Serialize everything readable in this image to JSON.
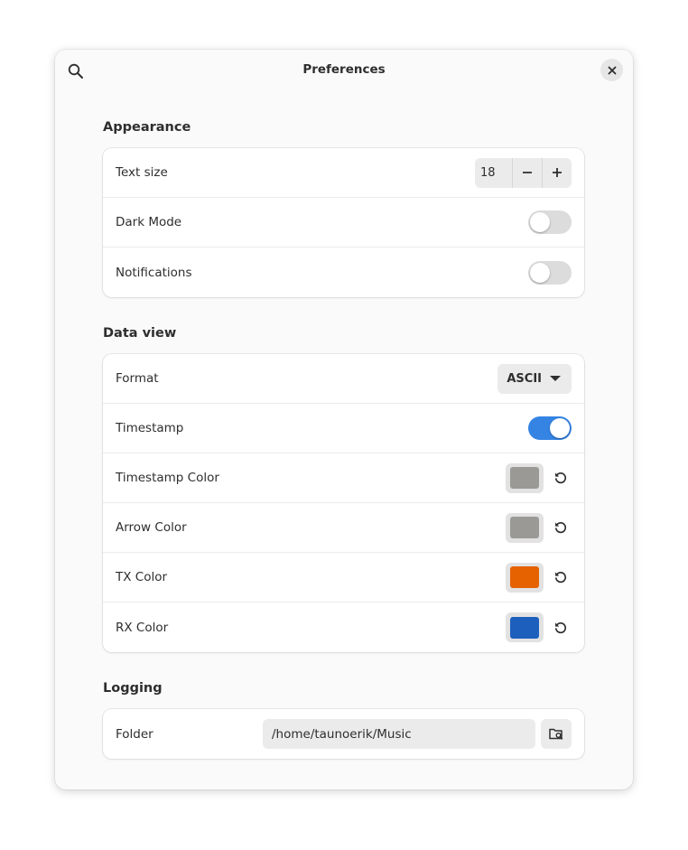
{
  "window": {
    "title": "Preferences"
  },
  "appearance": {
    "heading": "Appearance",
    "text_size": {
      "label": "Text size",
      "value": "18"
    },
    "dark_mode": {
      "label": "Dark Mode",
      "enabled": false
    },
    "notifications": {
      "label": "Notifications",
      "enabled": false
    }
  },
  "data_view": {
    "heading": "Data view",
    "format": {
      "label": "Format",
      "selected": "ASCII"
    },
    "timestamp": {
      "label": "Timestamp",
      "enabled": true
    },
    "timestamp_color": {
      "label": "Timestamp Color",
      "color": "#9a9996"
    },
    "arrow_color": {
      "label": "Arrow Color",
      "color": "#9a9996"
    },
    "tx_color": {
      "label": "TX Color",
      "color": "#e66100"
    },
    "rx_color": {
      "label": "RX Color",
      "color": "#1c5fbd"
    }
  },
  "logging": {
    "heading": "Logging",
    "folder": {
      "label": "Folder",
      "path": "/home/taunoerik/Music"
    }
  },
  "colors": {
    "accent": "#3584e4",
    "switch_off": "#dcdcdc"
  },
  "icons": {
    "search": "search-icon",
    "close": "close-icon",
    "minus": "minus-icon",
    "plus": "plus-icon",
    "dropdown": "chevron-down-icon",
    "reset": "reset-icon",
    "folder": "folder-search-icon"
  }
}
